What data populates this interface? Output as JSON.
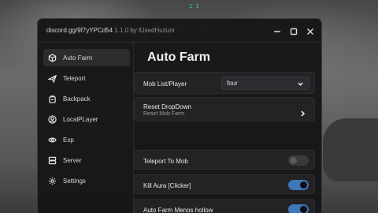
{
  "background": {
    "overhead_name": "ggggggggcxx",
    "hud_digits": "1        1"
  },
  "window": {
    "title_prefix": "discord.gg/9f7yYPCd54",
    "version": "1.1.0",
    "author": "by lUsedHuzuni",
    "controls": [
      "minimize-icon",
      "maximize-icon",
      "close-icon"
    ]
  },
  "sidebar": {
    "items": [
      {
        "label": "Auto Farm",
        "icon": "cube-icon",
        "active": true
      },
      {
        "label": "Teleport",
        "icon": "plane-icon",
        "active": false
      },
      {
        "label": "Backpack",
        "icon": "backpack-icon",
        "active": false
      },
      {
        "label": "LocalPLayer",
        "icon": "user-icon",
        "active": false
      },
      {
        "label": "Esp",
        "icon": "eye-icon",
        "active": false
      },
      {
        "label": "Server",
        "icon": "server-icon",
        "active": false
      },
      {
        "label": "Settings",
        "icon": "gear-icon",
        "active": false
      }
    ]
  },
  "main": {
    "title": "Auto Farm",
    "mob_list": {
      "label": "Mob List/Player",
      "value": "four"
    },
    "reset_dropdown": {
      "label": "Reset DropDown",
      "sublabel": "Reset Mob Farm"
    },
    "teleport_to_mob": {
      "label": "Teleport To Mob",
      "enabled": false
    },
    "kill_aura": {
      "label": "Kill Aura [Clicker]",
      "enabled": true
    },
    "auto_farm_menos": {
      "label": "Auto Farm Menos hollow",
      "enabled": true
    }
  },
  "colors": {
    "accent": "#3f76b8",
    "window_bg": "#161618",
    "row_bg": "#232326"
  }
}
